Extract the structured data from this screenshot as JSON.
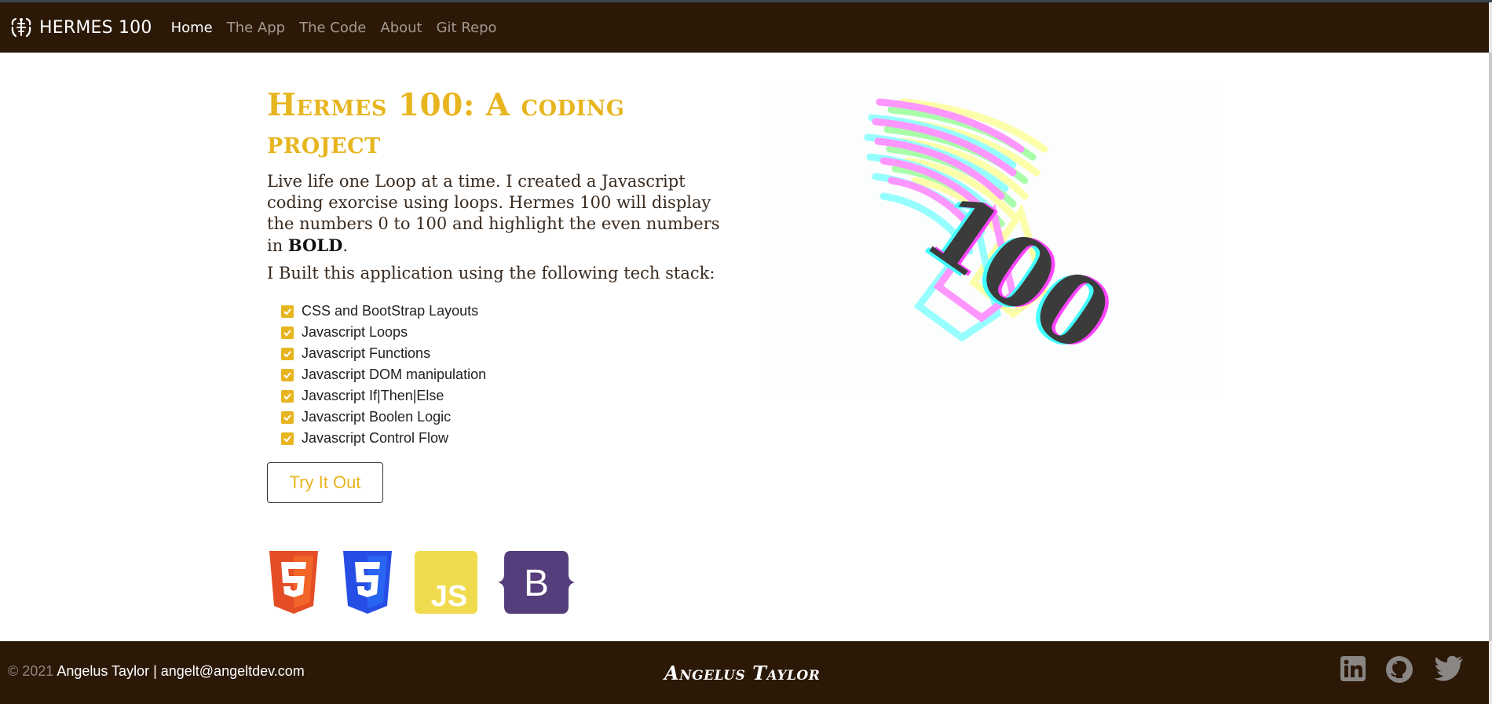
{
  "nav": {
    "brand_icon": "hermes-logo-icon",
    "brand": "HERMES 100",
    "links": [
      "Home",
      "The App",
      "The Code",
      "About",
      "Git Repo"
    ],
    "active": "Home"
  },
  "main": {
    "title": "Hermes 100: A coding project",
    "intro_text": "Live life one Loop at a time. I created a Javascript coding exorcise using loops. Hermes 100 will display the numbers 0 to 100 and highlight the even numbers in ",
    "intro_bold": "BOLD",
    "intro_end": ".",
    "stack_heading": "I Built this application using the following tech stack:",
    "stack_items": [
      "CSS and BootStrap Layouts",
      "Javascript Loops",
      "Javascript Functions",
      "Javascript DOM manipulation",
      "Javascript If|Then|Else",
      "Javascript Boolen Logic",
      "Javascript Control Flow"
    ],
    "cta": "Try It Out",
    "tech_icons": [
      {
        "name": "html5-icon",
        "color": "#e44d26"
      },
      {
        "name": "css3-icon",
        "color": "#264de4"
      },
      {
        "name": "javascript-icon",
        "color": "#f0db4f",
        "label": "JS"
      },
      {
        "name": "bootstrap-icon",
        "color": "#563d7c",
        "label": "B"
      }
    ]
  },
  "hero": {
    "image": "winged-foot-100-logo",
    "number": "100"
  },
  "footer": {
    "copyright": "© 2021",
    "author": "Angelus Taylor | angelt@angeltdev.com",
    "signature": "Angelus Taylor",
    "social": [
      "linkedin-icon",
      "github-icon",
      "twitter-icon"
    ]
  },
  "colors": {
    "accent": "#e7b51f",
    "nav_bg": "#2b1807",
    "text": "#3a2a1e"
  }
}
